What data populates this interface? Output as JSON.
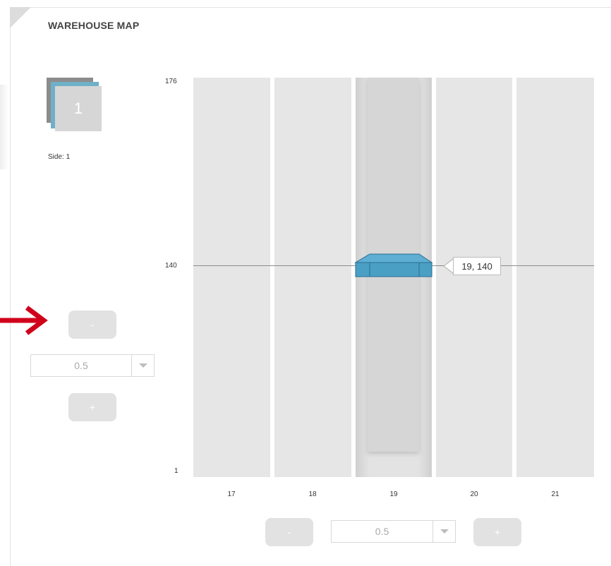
{
  "header": {
    "title": "WAREHOUSE MAP"
  },
  "side_selector": {
    "badge": "1",
    "label": "Side: 1"
  },
  "left_controls": {
    "minus": "-",
    "plus": "+",
    "zoom_value": "0.5"
  },
  "bottom_controls": {
    "minus": "-",
    "plus": "+",
    "zoom_value": "0.5"
  },
  "axes": {
    "y_ticks": [
      "176",
      "140",
      "1"
    ],
    "x_ticks": [
      "17",
      "18",
      "19",
      "20",
      "21"
    ]
  },
  "selection": {
    "column": "19",
    "row": "140",
    "tooltip": "19, 140"
  },
  "colors": {
    "selected_box": "#4a9fc4",
    "accent_arrow": "#d0021b"
  }
}
